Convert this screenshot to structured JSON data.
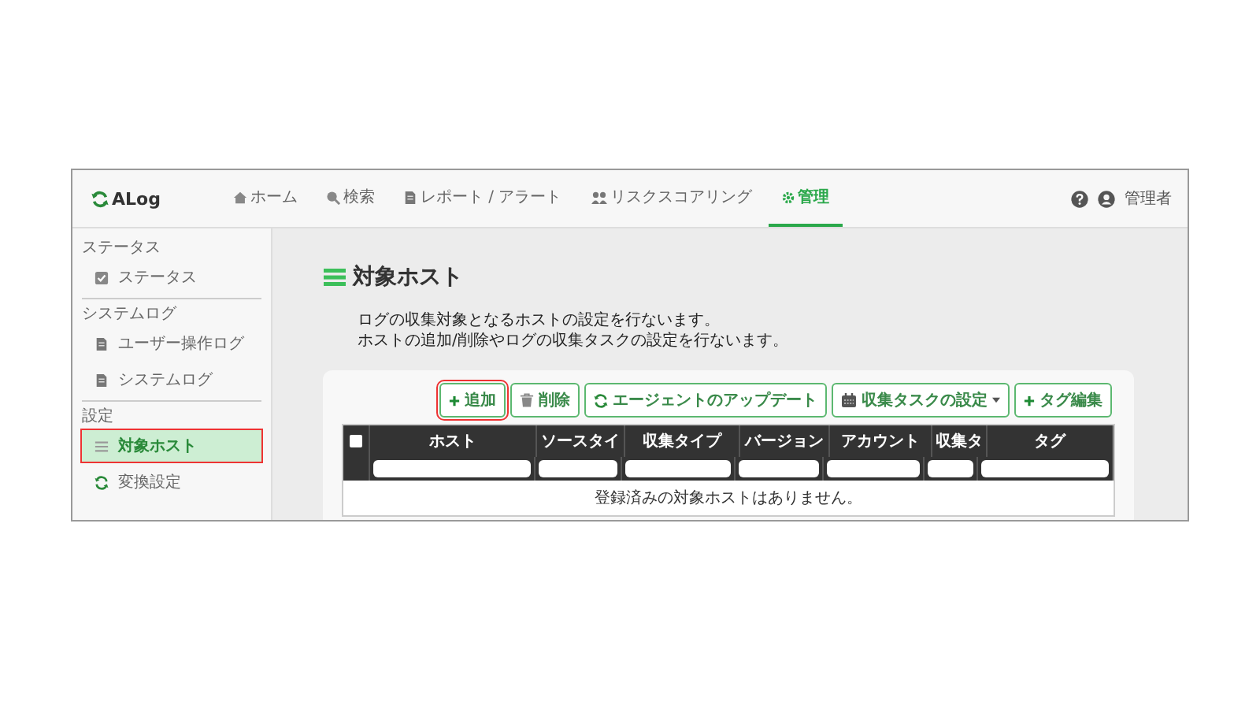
{
  "header": {
    "logo": "ALog",
    "nav": [
      {
        "label": "ホーム",
        "selected": false
      },
      {
        "label": "検索",
        "selected": false
      },
      {
        "label": "レポート / アラート",
        "selected": false
      },
      {
        "label": "リスクスコアリング",
        "selected": false
      },
      {
        "label": "管理",
        "selected": true
      }
    ],
    "user": "管理者"
  },
  "sidebar": {
    "sections": [
      {
        "title": "ステータス",
        "items": [
          {
            "label": "ステータス",
            "selected": false,
            "highlighted": false
          }
        ]
      },
      {
        "title": "システムログ",
        "items": [
          {
            "label": "ユーザー操作ログ",
            "selected": false,
            "highlighted": false
          },
          {
            "label": "システムログ",
            "selected": false,
            "highlighted": false
          }
        ]
      },
      {
        "title": "設定",
        "items": [
          {
            "label": "対象ホスト",
            "selected": true,
            "highlighted": true
          },
          {
            "label": "変換設定",
            "selected": false,
            "highlighted": false
          }
        ]
      }
    ]
  },
  "page": {
    "title": "対象ホスト",
    "description": [
      "ログの収集対象となるホストの設定を行ないます。",
      "ホストの追加/削除やログの収集タスクの設定を行ないます。"
    ]
  },
  "toolbar": [
    {
      "label": "追加",
      "highlighted": true,
      "dropdown": false
    },
    {
      "label": "削除",
      "highlighted": false,
      "dropdown": false
    },
    {
      "label": "エージェントのアップデート",
      "highlighted": false,
      "dropdown": false
    },
    {
      "label": "収集タスクの設定",
      "highlighted": false,
      "dropdown": true
    },
    {
      "label": "タグ編集",
      "highlighted": false,
      "dropdown": false
    }
  ],
  "table": {
    "select_all_checked": false,
    "columns": [
      "ホスト",
      "ソースタイ",
      "収集タイプ",
      "バージョン",
      "アカウント",
      "収集タ",
      "タグ"
    ],
    "empty_message": "登録済みの対象ホストはありません。"
  }
}
